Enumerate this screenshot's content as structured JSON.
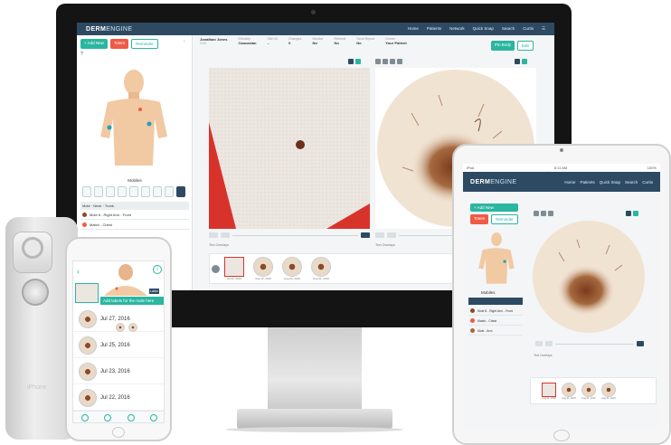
{
  "imac_app": {
    "logo_bold": "DERM",
    "logo_light": "ENGINE",
    "nav": [
      "Home",
      "Patients",
      "Network",
      "Quick Snap",
      "Search",
      "Curtis"
    ],
    "sidebar": {
      "add_new": "+ Add New",
      "totem": "Totem",
      "reminder": "Reminder",
      "body_label": "Mobiles",
      "list_header": "Mole  ·  Neck  ·  Trunk",
      "list_items": [
        "Mole 8 - Right Arm - Front",
        "Match - Chest"
      ]
    },
    "header_fields": [
      {
        "label": "Jonathan Jones",
        "value": "4:00"
      },
      {
        "label": "Ethnicity",
        "value": "Caucasian"
      },
      {
        "label": "Skin ID",
        "value": "–"
      },
      {
        "label": "Changes",
        "value": "0"
      },
      {
        "label": "Monitor",
        "value": "No"
      },
      {
        "label": "Referral",
        "value": "No"
      },
      {
        "label": "Send Report",
        "value": "No"
      },
      {
        "label": "Owner",
        "value": "Your Patient"
      }
    ],
    "header_buttons": [
      "Pin Body",
      "Edit"
    ],
    "notes_label_left": "Text Overlays",
    "notes_label_right": "Text Overlays",
    "thumb_dates": [
      "Jul 22, 2016",
      "Aug 12, 2016",
      "Aug 23, 2016",
      "Aug 31, 2016"
    ]
  },
  "ipad_app": {
    "status_left": "iPad",
    "status_center": "8:11 AM",
    "status_url": "dermengine.com",
    "status_right": "100%",
    "logo_bold": "DERM",
    "logo_light": "ENGINE",
    "nav": [
      "Home",
      "Patients",
      "Quick Snap",
      "Search",
      "Curtis"
    ],
    "add_new": "+ Add New",
    "totem": "Totem",
    "reminder": "Reminder",
    "body_label": "Mobiles",
    "list_items": [
      "Mole 8 - Right Arm - Front",
      "Match - Chest",
      "Mole - Arm"
    ],
    "notes_label": "Text Overlays",
    "thumb_dates": [
      "Aug 21, 2016",
      "Aug 21, 2016",
      "Aug 21, 2016",
      "Aug 21, 2016"
    ]
  },
  "phone_app": {
    "banner": "Add labels for the mole here",
    "header_tag": "Label",
    "rows": [
      {
        "date": "Jul 27, 2016"
      },
      {
        "date": "Jul 25, 2016"
      },
      {
        "date": "Jul 23, 2016"
      },
      {
        "date": "Jul 22, 2016"
      }
    ]
  },
  "scope_device": {
    "label": "iPhone"
  },
  "colors": {
    "navbar": "#2e4a63",
    "accent_teal": "#2ab6a0",
    "accent_red": "#ef5a45",
    "skin": "#f1c9a3",
    "lesion": "#8a4a28"
  }
}
